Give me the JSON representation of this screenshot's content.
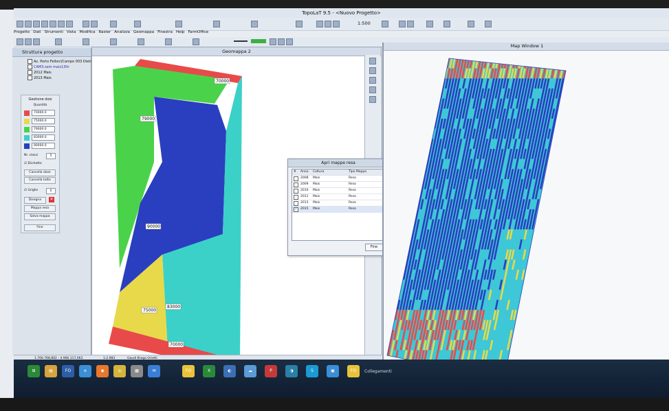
{
  "window": {
    "title": "TopoLaT 9.5 - <Nuovo Progetto>"
  },
  "menu": [
    "Progetto",
    "Dati",
    "Strumenti",
    "Vista",
    "Modifica",
    "Raster",
    "Analizza",
    "Geomappa",
    "Finestra",
    "Help",
    "FarmOffice"
  ],
  "toolbar": {
    "scale": "1:500"
  },
  "project_panel": {
    "title": "Struttura progetto",
    "items": [
      "Az. Porto Felloni/Campo 003 Dietro Ro",
      "CAM3.sem mais13th",
      "2012 Mais",
      "2013 Mais"
    ]
  },
  "dose_panel": {
    "title": "Gestione dosi",
    "qty_label": "Quantità",
    "rows": [
      {
        "idx": "1",
        "value": "70000.0",
        "color": "#e84a4a"
      },
      {
        "idx": "2",
        "value": "75000.0",
        "color": "#e8d94a"
      },
      {
        "idx": "3",
        "value": "79000.0",
        "color": "#4ad34a"
      },
      {
        "idx": "4",
        "value": "83000.0",
        "color": "#3bd1c9"
      },
      {
        "idx": "5",
        "value": "90000.0",
        "color": "#2a3fbf"
      }
    ],
    "classes_label": "Nr. classi",
    "classes_value": "5",
    "labels_label": "Etichette",
    "delete_doses": "Cancella dose",
    "delete_all": "Cancella tutto",
    "grid_label": "Griglie",
    "grid_value": "0",
    "draw_label": "Disegna",
    "yield_map": "Mappa resa",
    "save_map": "Salva mappa",
    "end": "Fine"
  },
  "geomap": {
    "title": "Geomappa 2",
    "zones": [
      {
        "label": "70000",
        "color": "#e84a4a"
      },
      {
        "label": "79000",
        "color": "#4ad34a"
      },
      {
        "label": "90000",
        "color": "#2a3fbf"
      },
      {
        "label": "75000",
        "color": "#e8d94a"
      },
      {
        "label": "83000",
        "color": "#3bd1c9"
      },
      {
        "label": "70000",
        "color": "#e84a4a"
      }
    ]
  },
  "dialog": {
    "title": "Apri mappe resa",
    "headers": [
      "#",
      "Anno",
      "Coltura",
      "Tipo Mappa"
    ],
    "rows": [
      {
        "year": "2008",
        "crop": "Mais",
        "type": "Resa",
        "checked": false
      },
      {
        "year": "2009",
        "crop": "Mais",
        "type": "Resa",
        "checked": false
      },
      {
        "year": "2010",
        "crop": "Mais",
        "type": "Resa",
        "checked": false
      },
      {
        "year": "2011",
        "crop": "Mais",
        "type": "Resa",
        "checked": false
      },
      {
        "year": "2013",
        "crop": "Mais",
        "type": "Resa",
        "checked": false
      },
      {
        "year": "2015",
        "crop": "Mais",
        "type": "Resa",
        "checked": true
      }
    ],
    "button": "Fine"
  },
  "map_window": {
    "title": "Map Window 1"
  },
  "status": {
    "coords": "1.700.768,802 - 4.966.117,063",
    "scale": "1:2.983",
    "user": "Gaudi Braga Orietti"
  },
  "taskbar": {
    "label": "Collegamenti"
  }
}
